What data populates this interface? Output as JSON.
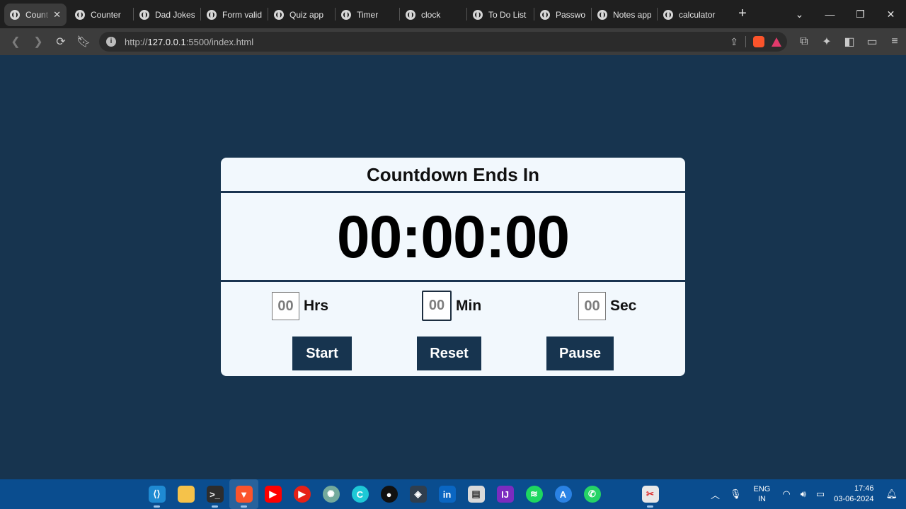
{
  "browser": {
    "tabs": [
      {
        "label": "Count",
        "active": true
      },
      {
        "label": "Counter"
      },
      {
        "label": "Dad Jokes"
      },
      {
        "label": "Form valid"
      },
      {
        "label": "Quiz app"
      },
      {
        "label": "Timer"
      },
      {
        "label": "clock"
      },
      {
        "label": "To Do List"
      },
      {
        "label": "Password"
      },
      {
        "label": "Notes app"
      },
      {
        "label": "calculator"
      }
    ],
    "url_prefix": "http://",
    "url_host": "127.0.0.1",
    "url_rest": ":5500/index.html"
  },
  "countdown": {
    "title": "Countdown Ends In",
    "display": "00:00:00",
    "hours": {
      "value": "00",
      "unit": "Hrs"
    },
    "minutes": {
      "value": "00",
      "unit": "Min"
    },
    "seconds": {
      "value": "00",
      "unit": "Sec"
    },
    "start_label": "Start",
    "reset_label": "Reset",
    "pause_label": "Pause",
    "accent_color": "#17344f"
  },
  "taskbar": {
    "lang_top": "ENG",
    "lang_bottom": "IN",
    "time": "17:46",
    "date": "03-06-2024"
  }
}
